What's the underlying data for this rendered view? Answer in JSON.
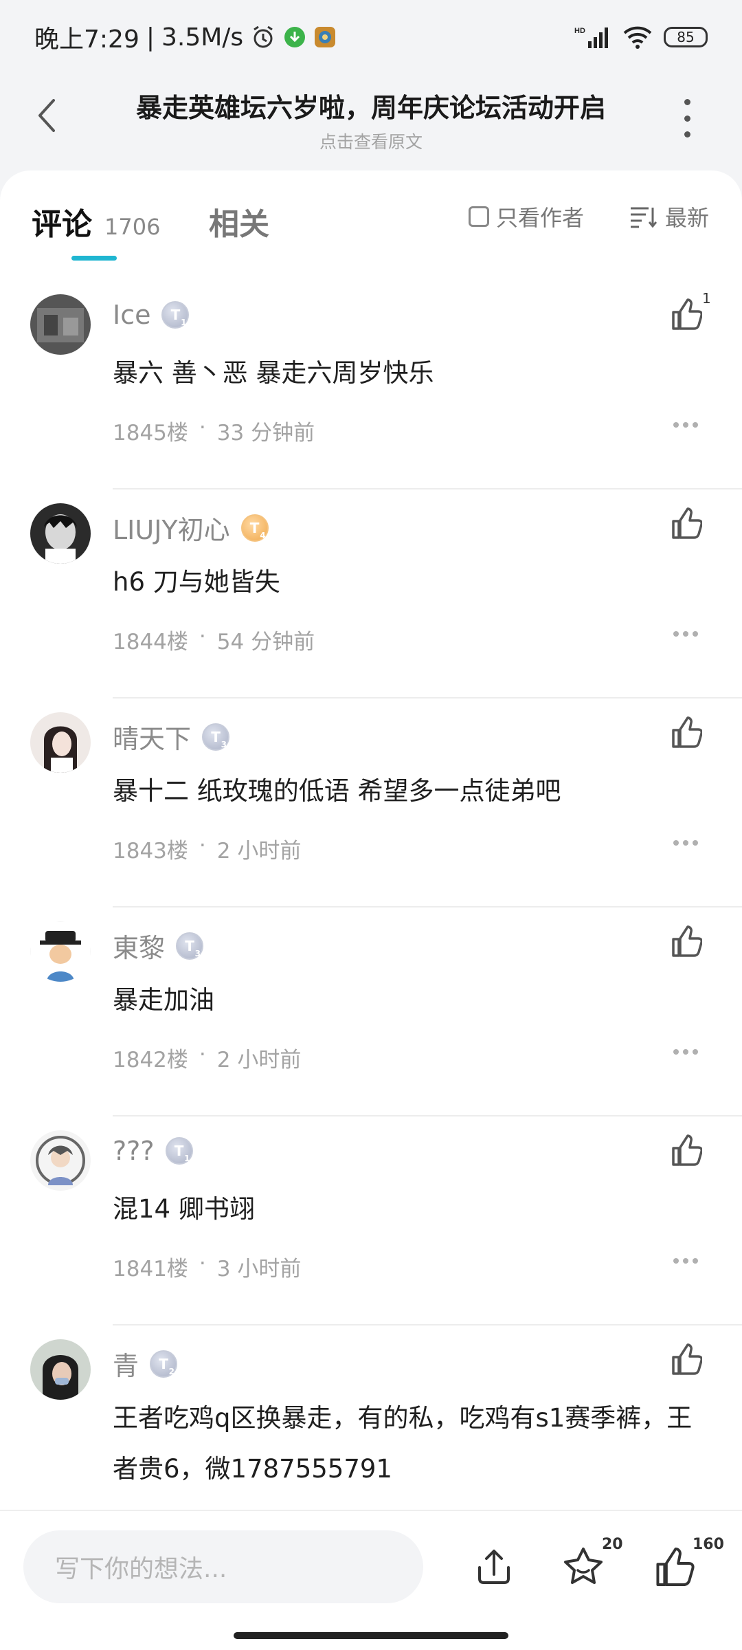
{
  "statusbar": {
    "time": "晚上7:29",
    "separator": "|",
    "speed": "3.5M/s",
    "network_label": "HD",
    "battery": "85"
  },
  "header": {
    "title": "暴走英雄坛六岁啦，周年庆论坛活动开启",
    "subtitle": "点击查看原文"
  },
  "tabs": {
    "comments_label": "评论",
    "comments_count": "1706",
    "related_label": "相关",
    "author_only_label": "只看作者",
    "sort_label": "最新"
  },
  "comments": [
    {
      "username": "Ice",
      "badge": "T",
      "badge_level": "1",
      "badge_color": "silver",
      "text": "暴六 善丶恶 暴走六周岁快乐",
      "floor": "1845楼",
      "dot": "·",
      "time": "33 分钟前",
      "likes": "1"
    },
    {
      "username": "LIUJY初心",
      "badge": "T",
      "badge_level": "4",
      "badge_color": "gold",
      "text": "h6 刀与她皆失",
      "floor": "1844楼",
      "dot": "·",
      "time": "54 分钟前",
      "likes": ""
    },
    {
      "username": "晴天下",
      "badge": "T",
      "badge_level": "3",
      "badge_color": "silver",
      "text": "暴十二 纸玫瑰的低语 希望多一点徒弟吧",
      "floor": "1843楼",
      "dot": "·",
      "time": "2 小时前",
      "likes": ""
    },
    {
      "username": "東黎",
      "badge": "T",
      "badge_level": "3",
      "badge_color": "silver",
      "text": "暴走加油",
      "floor": "1842楼",
      "dot": "·",
      "time": "2 小时前",
      "likes": ""
    },
    {
      "username": "???",
      "badge": "T",
      "badge_level": "1",
      "badge_color": "silver",
      "text": "混14 卿书翊",
      "floor": "1841楼",
      "dot": "·",
      "time": "3 小时前",
      "likes": ""
    },
    {
      "username": "青",
      "badge": "T",
      "badge_level": "2",
      "badge_color": "silver",
      "text": "王者吃鸡q区换暴走，有的私，吃鸡有s1赛季裤，王者贵6，微1787555791",
      "floor": "",
      "dot": "",
      "time": "",
      "likes": ""
    }
  ],
  "bottombar": {
    "input_placeholder": "写下你的想法...",
    "favorite_count": "20",
    "like_count": "160"
  },
  "colors": {
    "accent": "#1fb6d1",
    "background": "#f3f4f6",
    "muted_text": "#a3a3a3"
  },
  "icons": [
    "alarm-icon",
    "download-icon",
    "app-icon",
    "signal-icon",
    "wifi-icon",
    "battery-icon",
    "back-icon",
    "more-vertical-icon",
    "checkbox-icon",
    "sort-icon",
    "thumbs-up-icon",
    "more-horizontal-icon",
    "share-icon",
    "star-icon"
  ]
}
